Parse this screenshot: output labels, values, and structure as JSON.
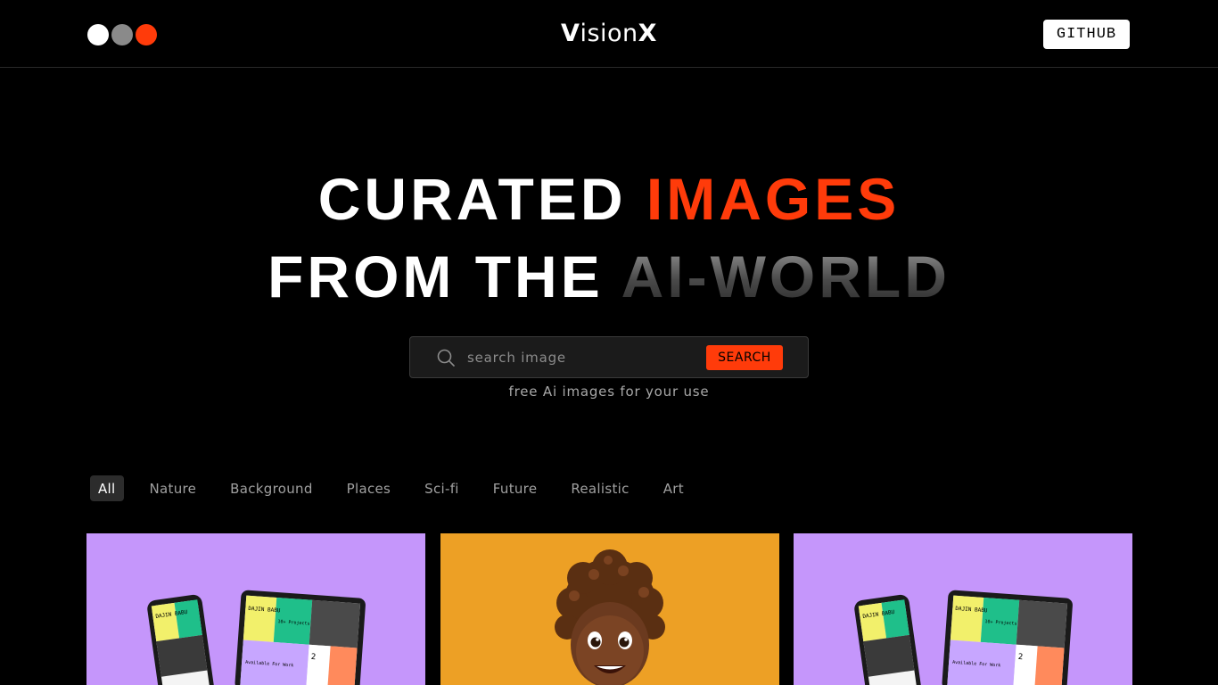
{
  "header": {
    "logo_dots": [
      "#ffffff",
      "#8a8a8a",
      "#ff3b0a"
    ],
    "brand_initial": "V",
    "brand_rest": "ision",
    "brand_end": "X",
    "github_label": "GITHUB"
  },
  "hero": {
    "line1_white": "CURATED",
    "line1_accent": "IMAGES",
    "line2_white": "FROM THE",
    "line2_fade": "AI-WORLD",
    "accent_color": "#ff3b0a"
  },
  "search": {
    "placeholder": "search image",
    "value": "",
    "button_label": "SEARCH",
    "icon": "search-icon"
  },
  "tagline": "free Ai images for your use",
  "filters": {
    "active": "All",
    "items": [
      "All",
      "Nature",
      "Background",
      "Places",
      "Sci-fi",
      "Future",
      "Realistic",
      "Art"
    ]
  },
  "gallery": {
    "cards": [
      {
        "background": "#c596fb",
        "subject": "phone and tablet portfolio mockup",
        "mock_name": "DAJIN BABU",
        "mock_stat": "10+ Projects",
        "mock_cta": "Available For Work",
        "mock_count": "2"
      },
      {
        "background": "#eda025",
        "subject": "3d cartoon child with curly hair"
      },
      {
        "background": "#c596fb",
        "subject": "phone and tablet portfolio mockup",
        "mock_name": "DAJIN BABU",
        "mock_stat": "10+ Projects",
        "mock_cta": "Available For Work",
        "mock_count": "2"
      }
    ]
  }
}
